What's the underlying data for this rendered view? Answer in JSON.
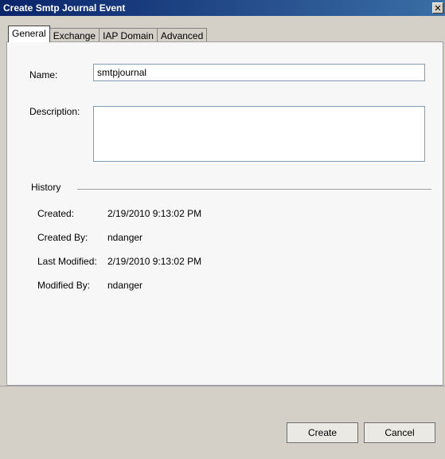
{
  "window": {
    "title": "Create Smtp Journal Event",
    "close_glyph": "✕"
  },
  "tabs": [
    {
      "label": "General",
      "active": true
    },
    {
      "label": "Exchange",
      "active": false
    },
    {
      "label": "IAP Domain",
      "active": false
    },
    {
      "label": "Advanced",
      "active": false
    }
  ],
  "form": {
    "name_label": "Name:",
    "name_value": "smtpjournal",
    "description_label": "Description:",
    "description_value": ""
  },
  "history": {
    "title": "History",
    "created_label": "Created:",
    "created_value": "2/19/2010 9:13:02 PM",
    "created_by_label": "Created By:",
    "created_by_value": "ndanger",
    "last_modified_label": "Last Modified:",
    "last_modified_value": "2/19/2010 9:13:02 PM",
    "modified_by_label": "Modified By:",
    "modified_by_value": "ndanger"
  },
  "buttons": {
    "create": "Create",
    "cancel": "Cancel"
  }
}
